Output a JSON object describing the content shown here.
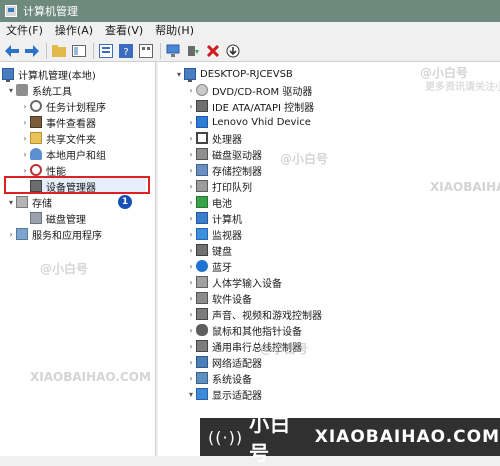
{
  "window": {
    "title": "计算机管理"
  },
  "menu": {
    "items": [
      "文件(F)",
      "操作(A)",
      "查看(V)",
      "帮助(H)"
    ]
  },
  "toolbar": {
    "icons": [
      "back-icon",
      "forward-icon",
      "folder-up-icon",
      "show-hide-tree-icon",
      "properties-icon",
      "help-icon",
      "view-icon",
      "monitor-icon",
      "update-driver-icon",
      "uninstall-icon",
      "scan-icon"
    ]
  },
  "left_tree": {
    "root": "计算机管理(本地)",
    "system_tools": "系统工具",
    "task_scheduler": "任务计划程序",
    "event_viewer": "事件查看器",
    "shared_folders": "共享文件夹",
    "local_users": "本地用户和组",
    "performance": "性能",
    "device_manager": "设备管理器",
    "storage": "存储",
    "disk_management": "磁盘管理",
    "services": "服务和应用程序"
  },
  "right_tree": {
    "root": "DESKTOP-RJCEVSB",
    "categories": [
      "DVD/CD-ROM 驱动器",
      "IDE ATA/ATAPI 控制器",
      "Lenovo Vhid Device",
      "处理器",
      "磁盘驱动器",
      "存储控制器",
      "打印队列",
      "电池",
      "计算机",
      "监视器",
      "键盘",
      "蓝牙",
      "人体学输入设备",
      "软件设备",
      "声音、视频和游戏控制器",
      "鼠标和其他指针设备",
      "通用串行总线控制器",
      "网络适配器",
      "系统设备",
      "显示适配器"
    ]
  },
  "annotation": {
    "badge": "1"
  },
  "watermark": {
    "tag": "@小白号",
    "site": "XIAOBAIHAO.COM",
    "sub": "更多资讯请关注小白号",
    "brand": "小白号",
    "bar_site": "XIAOBAIHAO.COM"
  },
  "colors": {
    "titlebar": "#6e8a7e",
    "highlight": "#dd2222",
    "badge": "#1a4fb5"
  }
}
